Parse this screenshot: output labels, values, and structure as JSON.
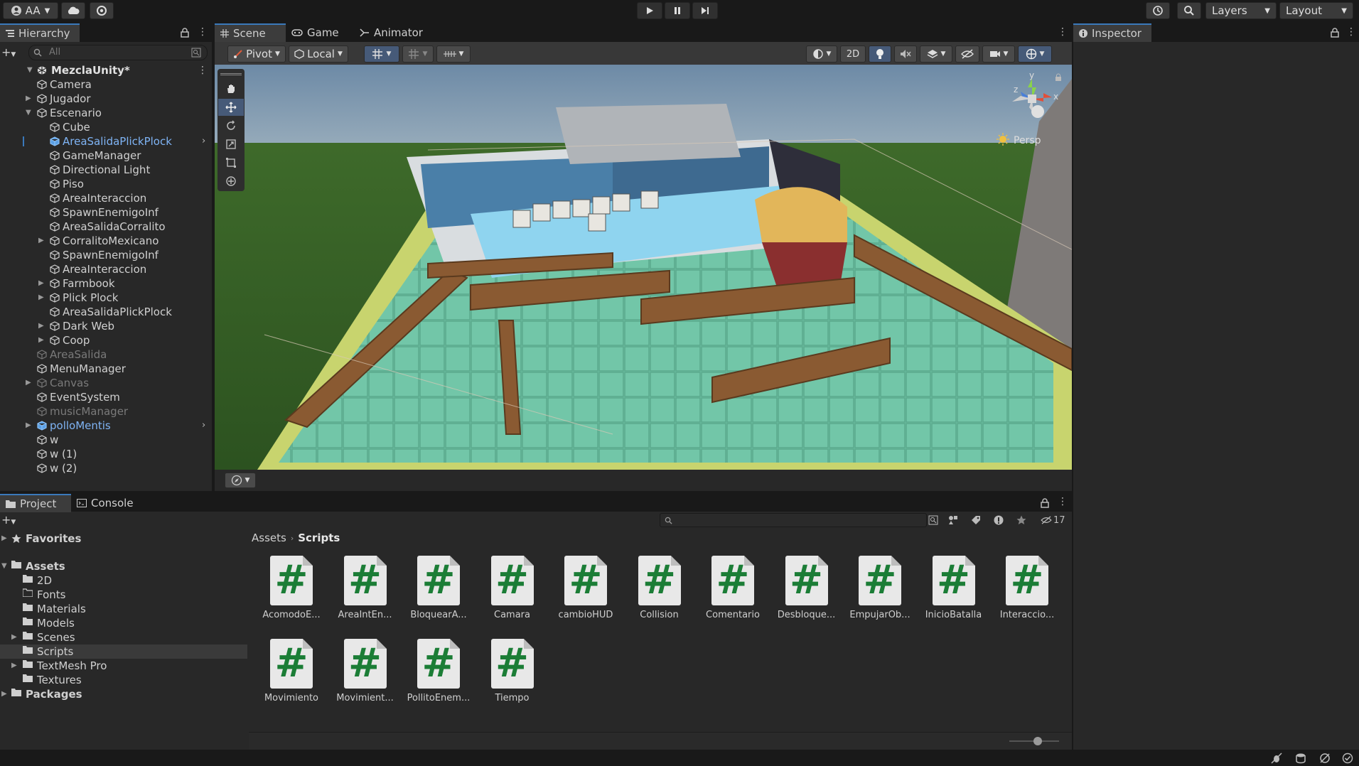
{
  "toolbar": {
    "account_label": "AA",
    "layers_label": "Layers",
    "layout_label": "Layout"
  },
  "hierarchy": {
    "tab_label": "Hierarchy",
    "search_placeholder": "All",
    "scene_name": "MezclaUnity*",
    "items": [
      {
        "label": "Camera"
      },
      {
        "label": "Jugador"
      },
      {
        "label": "Escenario"
      },
      {
        "label": "Cube"
      },
      {
        "label": "AreaSalidaPlickPlock"
      },
      {
        "label": "GameManager"
      },
      {
        "label": "Directional Light"
      },
      {
        "label": "Piso"
      },
      {
        "label": "AreaInteraccion"
      },
      {
        "label": "SpawnEnemigoInf"
      },
      {
        "label": "AreaSalidaCorralito"
      },
      {
        "label": "CorralitoMexicano"
      },
      {
        "label": "SpawnEnemigoInf"
      },
      {
        "label": "AreaInteraccion"
      },
      {
        "label": "Farmbook"
      },
      {
        "label": "Plick Plock"
      },
      {
        "label": "AreaSalidaPlickPlock"
      },
      {
        "label": "Dark Web"
      },
      {
        "label": "Coop"
      },
      {
        "label": "AreaSalida"
      },
      {
        "label": "MenuManager"
      },
      {
        "label": "Canvas"
      },
      {
        "label": "EventSystem"
      },
      {
        "label": "musicManager"
      },
      {
        "label": "polloMentis"
      },
      {
        "label": "w"
      },
      {
        "label": "w (1)"
      },
      {
        "label": "w (2)"
      }
    ]
  },
  "scene": {
    "tabs": [
      {
        "label": "Scene"
      },
      {
        "label": "Game"
      },
      {
        "label": "Animator"
      }
    ],
    "pivot_label": "Pivot",
    "local_label": "Local",
    "mode_2d": "2D",
    "persp_label": "Persp",
    "axis_y": "y",
    "axis_x": "x",
    "axis_z": "z"
  },
  "inspector": {
    "tab_label": "Inspector"
  },
  "project": {
    "tabs": [
      {
        "label": "Project"
      },
      {
        "label": "Console"
      }
    ],
    "hidden_count": "17",
    "favorites_label": "Favorites",
    "assets_label": "Assets",
    "folders": [
      {
        "label": "2D"
      },
      {
        "label": "Fonts"
      },
      {
        "label": "Materials"
      },
      {
        "label": "Models"
      },
      {
        "label": "Scenes"
      },
      {
        "label": "Scripts"
      },
      {
        "label": "TextMesh Pro"
      },
      {
        "label": "Textures"
      }
    ],
    "packages_label": "Packages",
    "breadcrumb": [
      "Assets",
      "Scripts"
    ],
    "scripts": [
      {
        "name": "AcomodoE..."
      },
      {
        "name": "AreaIntEn..."
      },
      {
        "name": "BloquearA..."
      },
      {
        "name": "Camara"
      },
      {
        "name": "cambioHUD"
      },
      {
        "name": "Collision"
      },
      {
        "name": "Comentario"
      },
      {
        "name": "Desbloque..."
      },
      {
        "name": "EmpujarOb..."
      },
      {
        "name": "InicioBatalla"
      },
      {
        "name": "Interaccio..."
      },
      {
        "name": "Movimiento"
      },
      {
        "name": "Movimient..."
      },
      {
        "name": "PollitoEnem..."
      },
      {
        "name": "Tiempo"
      }
    ]
  },
  "colors": {
    "accent": "#3a79bb",
    "selected_text": "#7fb4f5",
    "script_hash": "#1b7d36"
  }
}
